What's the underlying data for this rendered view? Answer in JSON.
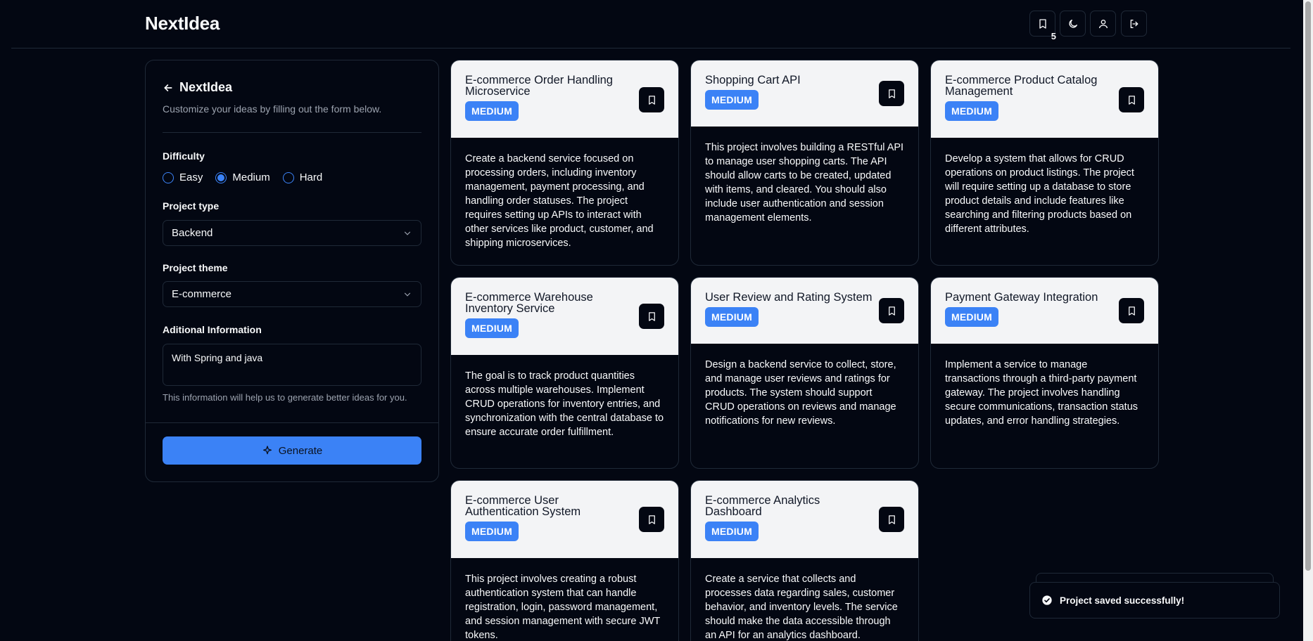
{
  "app": {
    "brand": "NextIdea",
    "saved_count": "5",
    "colors": {
      "background": "#030712",
      "accent": "#3b82f6",
      "card_header": "#f3f4f6"
    }
  },
  "header": {
    "icons": [
      "bookmark-icon",
      "moon-icon",
      "user-icon",
      "logout-icon"
    ]
  },
  "sidebar": {
    "title": "NextIdea",
    "subtitle": "Customize your ideas by filling out the form below.",
    "difficulty_label": "Difficulty",
    "difficulty_options": [
      {
        "label": "Easy",
        "checked": false
      },
      {
        "label": "Medium",
        "checked": true
      },
      {
        "label": "Hard",
        "checked": false
      }
    ],
    "project_type_label": "Project type",
    "project_type_value": "Backend",
    "project_theme_label": "Project theme",
    "project_theme_value": "E-commerce",
    "additional_label": "Aditional Information",
    "additional_value": "With Spring and java",
    "hint": "This information will help us to generate better ideas for you.",
    "generate_label": "Generate"
  },
  "cards": [
    {
      "title": "E-commerce Order Handling Microservice",
      "difficulty": "MEDIUM",
      "description": "Create a backend service focused on processing orders, including inventory management, payment processing, and handling order statuses. The project requires setting up APIs to interact with other services like product, customer, and shipping microservices."
    },
    {
      "title": "Shopping Cart API",
      "difficulty": "MEDIUM",
      "description": "This project involves building a RESTful API to manage user shopping carts. The API should allow carts to be created, updated with items, and cleared. You should also include user authentication and session management elements."
    },
    {
      "title": "E-commerce Product Catalog Management",
      "difficulty": "MEDIUM",
      "description": "Develop a system that allows for CRUD operations on product listings. The project will require setting up a database to store product details and include features like searching and filtering products based on different attributes."
    },
    {
      "title": "E-commerce Warehouse Inventory Service",
      "difficulty": "MEDIUM",
      "description": "The goal is to track product quantities across multiple warehouses. Implement CRUD operations for inventory entries, and synchronization with the central database to ensure accurate order fulfillment."
    },
    {
      "title": "User Review and Rating System",
      "difficulty": "MEDIUM",
      "description": "Design a backend service to collect, store, and manage user reviews and ratings for products. The system should support CRUD operations on reviews and manage notifications for new reviews."
    },
    {
      "title": "Payment Gateway Integration",
      "difficulty": "MEDIUM",
      "description": "Implement a service to manage transactions through a third-party payment gateway. The project involves handling secure communications, transaction status updates, and error handling strategies."
    },
    {
      "title": "E-commerce User Authentication System",
      "difficulty": "MEDIUM",
      "description": "This project involves creating a robust authentication system that can handle registration, login, password management, and session management with secure JWT tokens."
    },
    {
      "title": "E-commerce Analytics Dashboard",
      "difficulty": "MEDIUM",
      "description": "Create a service that collects and processes data regarding sales, customer behavior, and inventory levels. The service should make the data accessible through an API for an analytics dashboard."
    }
  ],
  "toast": {
    "message": "Project saved successfully!",
    "icon": "check-circle-icon"
  }
}
